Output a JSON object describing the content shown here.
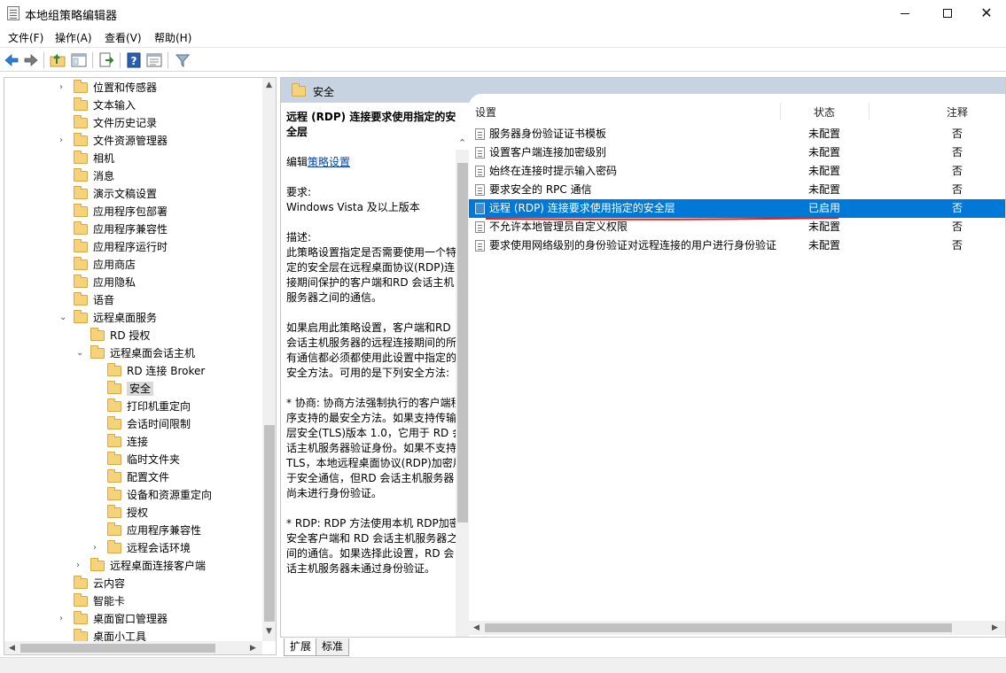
{
  "window": {
    "title": "本地组策略编辑器"
  },
  "menu": [
    "文件(F)",
    "操作(A)",
    "查看(V)",
    "帮助(H)"
  ],
  "toolbar": {
    "icons": [
      "back-arrow-icon",
      "forward-arrow-icon",
      "up-folder-icon",
      "show-hide-tree-icon",
      "export-list-icon",
      "help-icon",
      "properties-icon",
      "filter-icon"
    ]
  },
  "tree": {
    "items": [
      {
        "label": "位置和传感器",
        "expander": "›"
      },
      {
        "label": "文本输入",
        "expander": ""
      },
      {
        "label": "文件历史记录",
        "expander": ""
      },
      {
        "label": "文件资源管理器",
        "expander": "›"
      },
      {
        "label": "相机",
        "expander": ""
      },
      {
        "label": "消息",
        "expander": ""
      },
      {
        "label": "演示文稿设置",
        "expander": ""
      },
      {
        "label": "应用程序包部署",
        "expander": ""
      },
      {
        "label": "应用程序兼容性",
        "expander": ""
      },
      {
        "label": "应用程序运行时",
        "expander": ""
      },
      {
        "label": "应用商店",
        "expander": ""
      },
      {
        "label": "应用隐私",
        "expander": ""
      },
      {
        "label": "语音",
        "expander": ""
      },
      {
        "label": "远程桌面服务",
        "expander": "⌄"
      },
      {
        "label": "RD 授权",
        "expander": ""
      },
      {
        "label": "远程桌面会话主机",
        "expander": "⌄"
      },
      {
        "label": "RD 连接 Broker",
        "expander": ""
      },
      {
        "label": "安全",
        "expander": ""
      },
      {
        "label": "打印机重定向",
        "expander": ""
      },
      {
        "label": "会话时间限制",
        "expander": ""
      },
      {
        "label": "连接",
        "expander": ""
      },
      {
        "label": "临时文件夹",
        "expander": ""
      },
      {
        "label": "配置文件",
        "expander": ""
      },
      {
        "label": "设备和资源重定向",
        "expander": ""
      },
      {
        "label": "授权",
        "expander": ""
      },
      {
        "label": "应用程序兼容性",
        "expander": ""
      },
      {
        "label": "远程会话环境",
        "expander": "›"
      },
      {
        "label": "远程桌面连接客户端",
        "expander": "›"
      },
      {
        "label": "云内容",
        "expander": ""
      },
      {
        "label": "智能卡",
        "expander": ""
      },
      {
        "label": "桌面窗口管理器",
        "expander": "›"
      },
      {
        "label": "桌面小工具",
        "expander": ""
      }
    ],
    "selected": "安全"
  },
  "right": {
    "header": "安全",
    "description": {
      "title": "远程 (RDP) 连接要求使用指定的安全层",
      "edit_prefix": "编辑",
      "edit_link": "策略设置",
      "requirements_label": "要求:",
      "requirements_value": "Windows Vista 及以上版本",
      "desc_label": "描述:",
      "desc_p1": "此策略设置指定是否需要使用一个特定的安全层在远程桌面协议(RDP)连接期间保护的客户端和RD 会话主机服务器之间的通信。",
      "desc_p2": "如果启用此策略设置，客户端和RD 会话主机服务器的远程连接期间的所有通信都必须都使用此设置中指定的安全方法。可用的是下列安全方法:",
      "desc_p3": " * 协商: 协商方法强制执行的客户端程序支持的最安全方法。如果支持传输层安全(TLS)版本 1.0，它用于 RD 会话主机服务器验证身份。如果不支持 TLS，本地远程桌面协议(RDP)加密用于安全通信，但RD 会话主机服务器尚未进行身份验证。",
      "desc_p4": " * RDP: RDP 方法使用本机 RDP加密安全客户端和 RD 会话主机服务器之间的通信。如果选择此设置，RD 会话主机服务器未通过身份验证。"
    },
    "columns": {
      "setting": "设置",
      "state": "状态",
      "note": "注释"
    },
    "rows": [
      {
        "name": "服务器身份验证证书模板",
        "state": "未配置",
        "note": "否"
      },
      {
        "name": "设置客户端连接加密级别",
        "state": "未配置",
        "note": "否"
      },
      {
        "name": "始终在连接时提示输入密码",
        "state": "未配置",
        "note": "否"
      },
      {
        "name": "要求安全的 RPC 通信",
        "state": "未配置",
        "note": "否"
      },
      {
        "name": "远程 (RDP) 连接要求使用指定的安全层",
        "state": "已启用",
        "note": "否"
      },
      {
        "name": "不允许本地管理员自定义权限",
        "state": "未配置",
        "note": "否"
      },
      {
        "name": "要求使用网络级别的身份验证对远程连接的用户进行身份验证",
        "state": "未配置",
        "note": "否"
      }
    ],
    "selected_row": 4,
    "tabs": [
      "扩展",
      "标准"
    ]
  },
  "colors": {
    "selection": "#0078d7",
    "header_band": "#c7d3e1",
    "annotation_underline": "#e0201c",
    "link": "#0645ad"
  }
}
